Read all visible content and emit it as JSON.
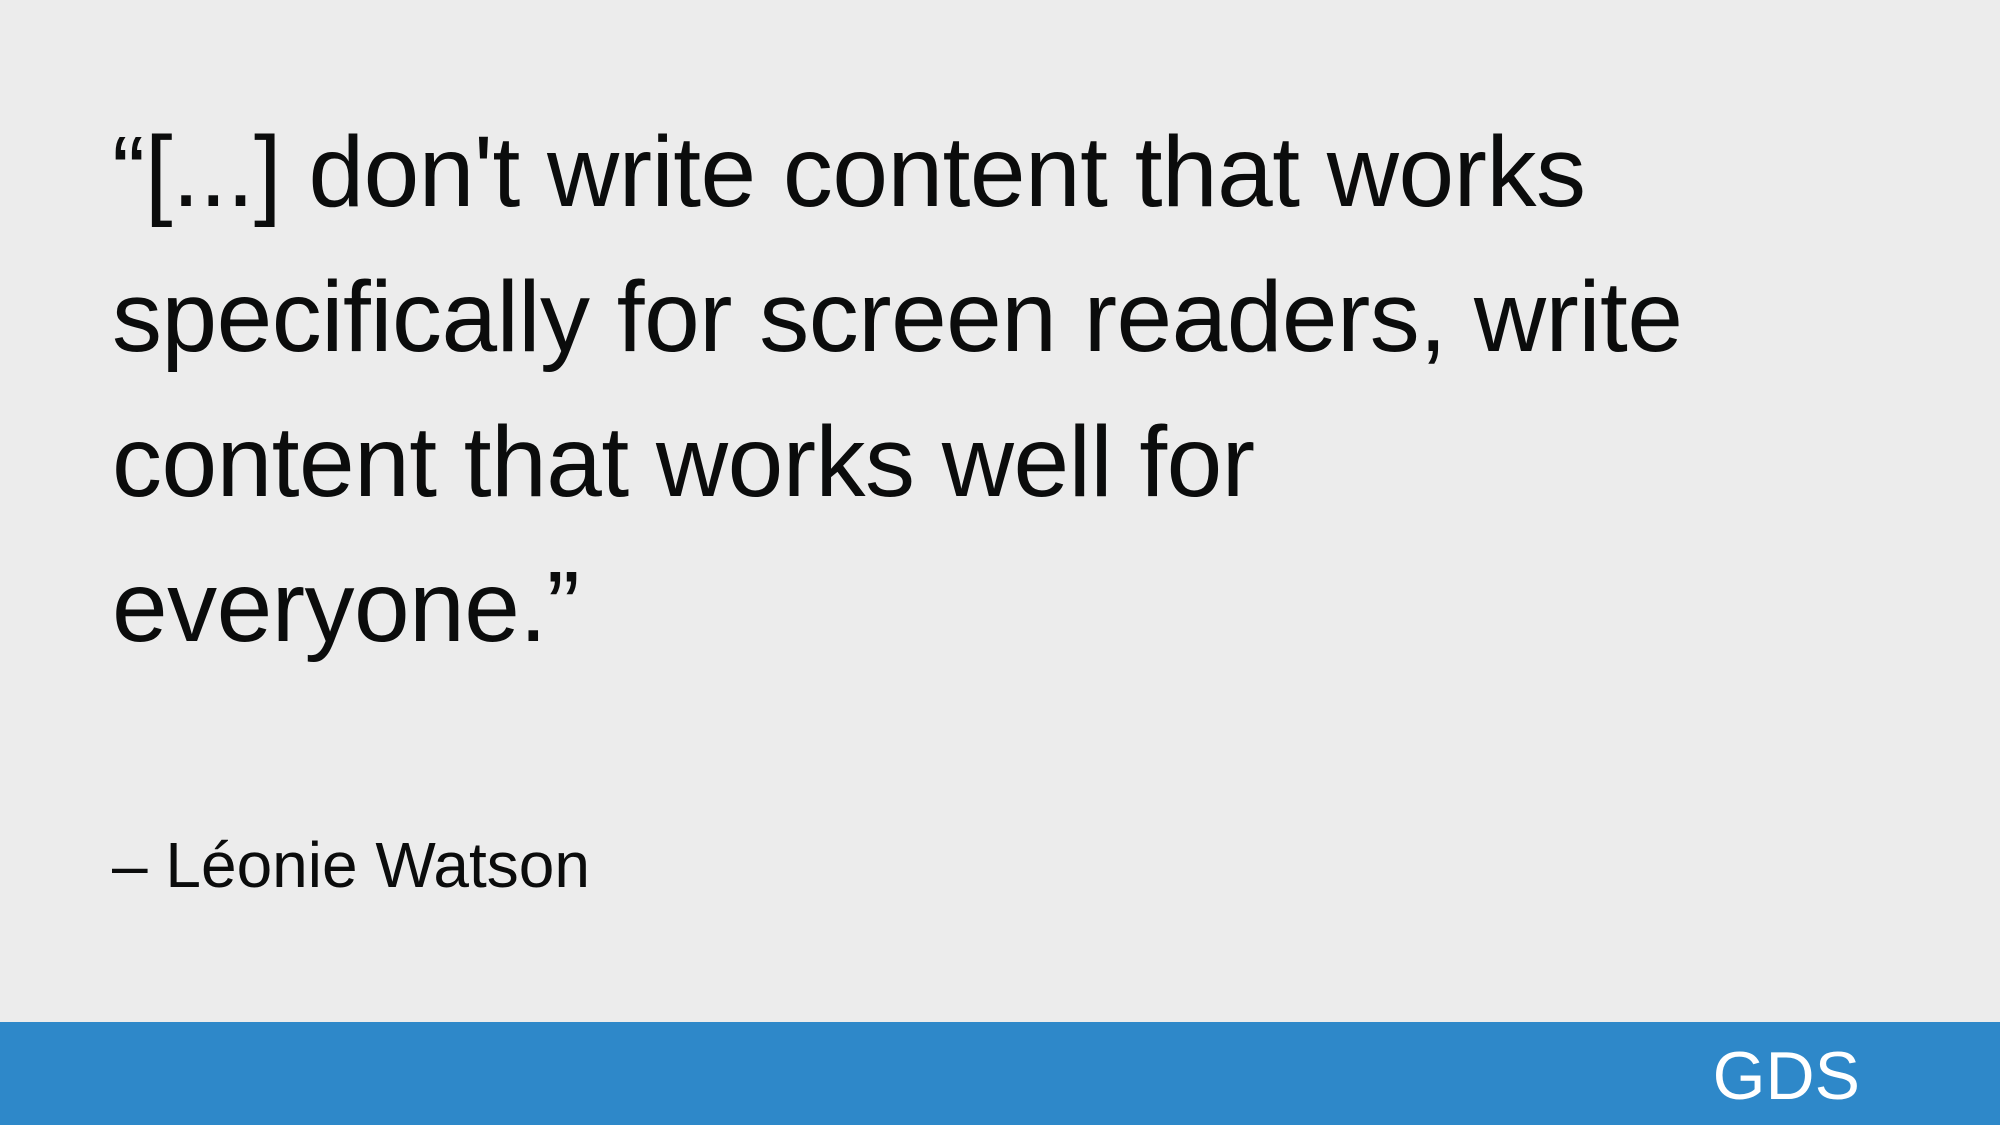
{
  "slide": {
    "quote_lines": [
      "“[...] don't write content that works",
      "specifically for screen readers, write",
      "content that works well for",
      "everyone.”"
    ],
    "attribution": "– Léonie Watson",
    "footer": {
      "logo_text": "GDS",
      "bar_color": "#2e88c9",
      "text_color": "#ffffff"
    },
    "background_color": "#ececec"
  }
}
